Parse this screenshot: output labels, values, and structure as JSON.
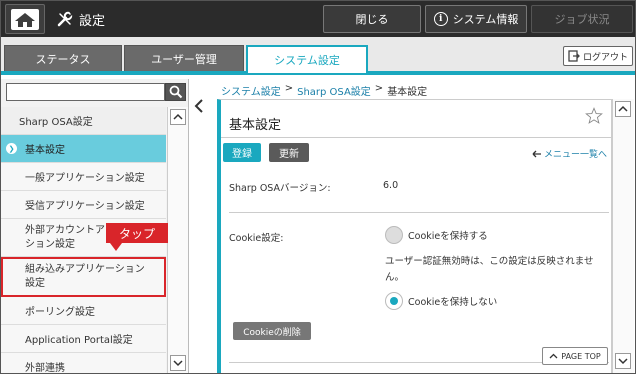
{
  "topbar": {
    "title": "設定",
    "close_label": "閉じる",
    "sysinfo_label": "システム情報",
    "job_label": "ジョブ状況",
    "icons": [
      "home-icon",
      "wrench-icon",
      "info-icon"
    ]
  },
  "tabs": {
    "status": "ステータス",
    "user": "ユーザー管理",
    "system": "システム設定",
    "logout": "ログアウト"
  },
  "search": {
    "value": "",
    "placeholder": ""
  },
  "sidebar": {
    "items": [
      {
        "label": "Sharp OSA設定"
      },
      {
        "label": "基本設定"
      },
      {
        "label": "一般アプリケーション設定"
      },
      {
        "label": "受信アプリケーション設定"
      },
      {
        "label_line1": "外部アカウントア",
        "label_line2": "ション設定"
      },
      {
        "label_line1": "組み込みアプリケーション",
        "label_line2": "設定"
      },
      {
        "label": "ポーリング設定"
      },
      {
        "label": "Application Portal設定"
      },
      {
        "label": "外部連携"
      }
    ],
    "callout": "タップ"
  },
  "breadcrumb": {
    "part1": "システム設定",
    "sep": ">",
    "part2": "Sharp OSA設定",
    "part3": "基本設定"
  },
  "panel": {
    "title": "基本設定",
    "register_label": "登録",
    "update_label": "更新",
    "menu_list_label": "メニュー一覧へ",
    "version_label": "Sharp OSAバージョン:",
    "version_value": "6.0",
    "cookie_label": "Cookie設定:",
    "cookie_keep": "Cookieを保持する",
    "cookie_note": "ユーザー認証無効時は、この設定は反映されません。",
    "cookie_nokeep": "Cookieを保持しない",
    "cookie_delete": "Cookieの削除",
    "pagetop_label": "PAGE TOP"
  },
  "colors": {
    "accent": "#1aa8bf",
    "active_item": "#69ccdd",
    "callout": "#d9252a",
    "topbar": "#2b2b2b"
  }
}
